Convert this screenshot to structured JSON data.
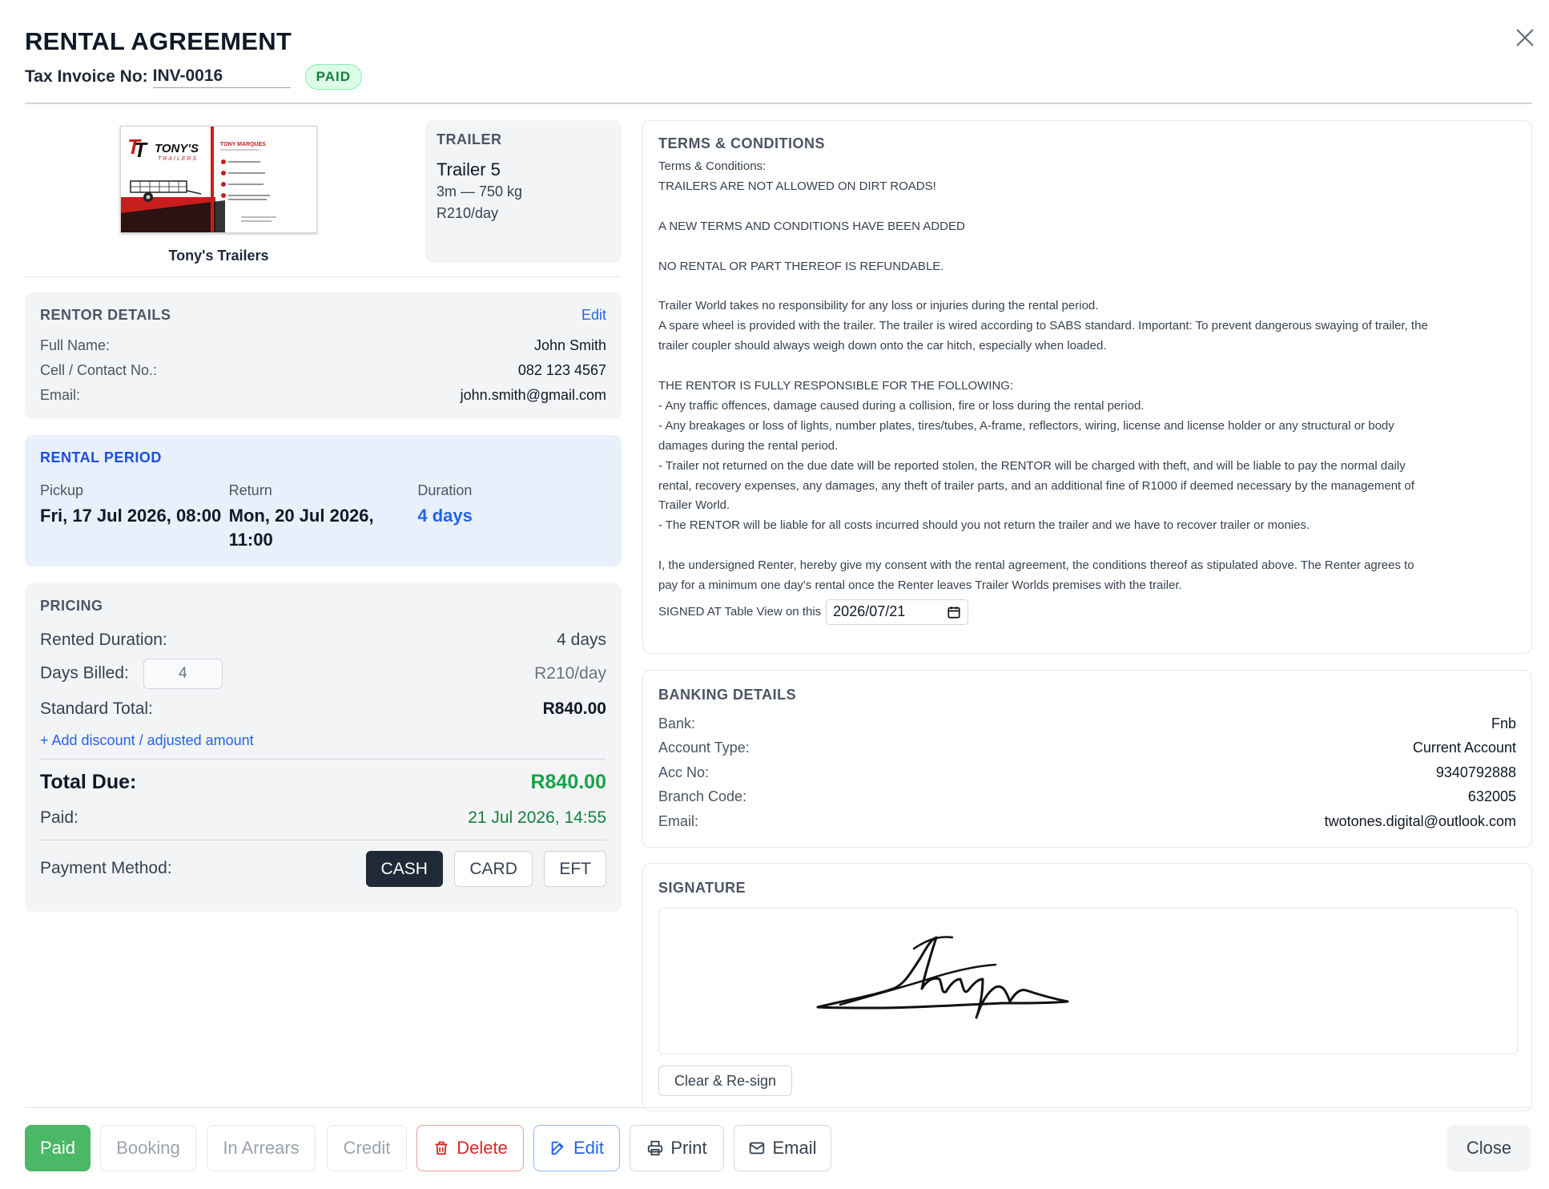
{
  "header": {
    "title": "RENTAL AGREEMENT",
    "invoice_label": "Tax Invoice No:",
    "invoice_no": "INV-0016",
    "status_badge": "PAID"
  },
  "business": {
    "name": "Tony's Trailers",
    "card_brand": "TONY'S",
    "card_sub": "TRAILERS",
    "card_person": "TONY MARQUES"
  },
  "trailer": {
    "label": "TRAILER",
    "name": "Trailer 5",
    "spec": "3m — 750 kg",
    "rate": "R210/day"
  },
  "rentor": {
    "label": "RENTOR DETAILS",
    "edit_label": "Edit",
    "fields": [
      {
        "key": "Full Name:",
        "value": "John Smith"
      },
      {
        "key": "Cell / Contact No.:",
        "value": "082 123 4567"
      },
      {
        "key": "Email:",
        "value": "john.smith@gmail.com"
      }
    ]
  },
  "period": {
    "label": "RENTAL PERIOD",
    "pickup_label": "Pickup",
    "pickup_value": "Fri, 17 Jul 2026, 08:00",
    "return_label": "Return",
    "return_value_line1": "Mon, 20 Jul 2026,",
    "return_value_line2": "11:00",
    "duration_label": "Duration",
    "duration_value": "4 days"
  },
  "pricing": {
    "label": "PRICING",
    "rented_duration_label": "Rented Duration:",
    "rented_duration_value": "4 days",
    "days_billed_label": "Days Billed:",
    "days_billed_value": "4",
    "rate": "R210/day",
    "standard_total_label": "Standard Total:",
    "standard_total_value": "R840.00",
    "add_discount_label": "+ Add discount / adjusted amount",
    "total_due_label": "Total Due:",
    "total_due_value": "R840.00",
    "paid_label": "Paid:",
    "paid_value": "21 Jul 2026, 14:55",
    "payment_method_label": "Payment Method:",
    "payment_methods": [
      "CASH",
      "CARD",
      "EFT"
    ],
    "selected_method": "CASH"
  },
  "terms": {
    "label": "TERMS & CONDITIONS",
    "body": "Terms & Conditions:\nTRAILERS ARE NOT ALLOWED ON DIRT ROADS!\n\nA NEW TERMS AND CONDITIONS HAVE BEEN ADDED\n\nNO RENTAL OR PART THEREOF IS REFUNDABLE.\n\nTrailer World takes no responsibility for any loss or injuries during the rental period.\nA spare wheel is provided with the trailer. The trailer is wired according to SABS standard. Important: To prevent dangerous swaying of trailer, the\ntrailer coupler should always weigh down onto the car hitch, especially when loaded.\n\nTHE RENTOR IS FULLY RESPONSIBLE FOR THE FOLLOWING:\n- Any traffic offences, damage caused during a collision, fire or loss during the rental period.\n- Any breakages or loss of lights, number plates, tires/tubes, A-frame, reflectors, wiring, license and license holder or any structural or body\ndamages during the rental period.\n- Trailer not returned on the due date will be reported stolen, the RENTOR will be charged with theft, and will be liable to pay the normal daily\nrental, recovery expenses, any damages, any theft of trailer parts, and an additional fine of R1000 if deemed necessary by the management of\nTrailer World.\n- The RENTOR will be liable for all costs incurred should you not return the trailer and we have to recover trailer or monies.\n\nI, the undersigned Renter, hereby give my consent with the rental agreement, the conditions thereof as stipulated above. The Renter agrees to\npay for a minimum one day's rental once the Renter leaves Trailer Worlds premises with the trailer.",
    "signed_at_label": "SIGNED AT Table View on this",
    "signed_date": "2026/07/21"
  },
  "banking": {
    "label": "BANKING DETAILS",
    "fields": [
      {
        "key": "Bank:",
        "value": "Fnb"
      },
      {
        "key": "Account Type:",
        "value": "Current Account"
      },
      {
        "key": "Acc No:",
        "value": "9340792888"
      },
      {
        "key": "Branch Code:",
        "value": "632005"
      },
      {
        "key": "Email:",
        "value": "twotones.digital@outlook.com"
      }
    ]
  },
  "signature": {
    "label": "SIGNATURE",
    "clear_label": "Clear & Re-sign"
  },
  "footer": {
    "paid": "Paid",
    "booking": "Booking",
    "in_arrears": "In Arrears",
    "credit": "Credit",
    "delete": "Delete",
    "edit": "Edit",
    "print": "Print",
    "email": "Email",
    "close": "Close"
  },
  "colors": {
    "accent_blue": "#2563eb",
    "paid_green": "#4ab866",
    "total_green": "#16a34a",
    "danger_red": "#dc2626",
    "dark": "#1f2937"
  },
  "icons": [
    "close-icon",
    "trash-icon",
    "edit-icon",
    "printer-icon",
    "mail-icon",
    "calendar-icon"
  ]
}
